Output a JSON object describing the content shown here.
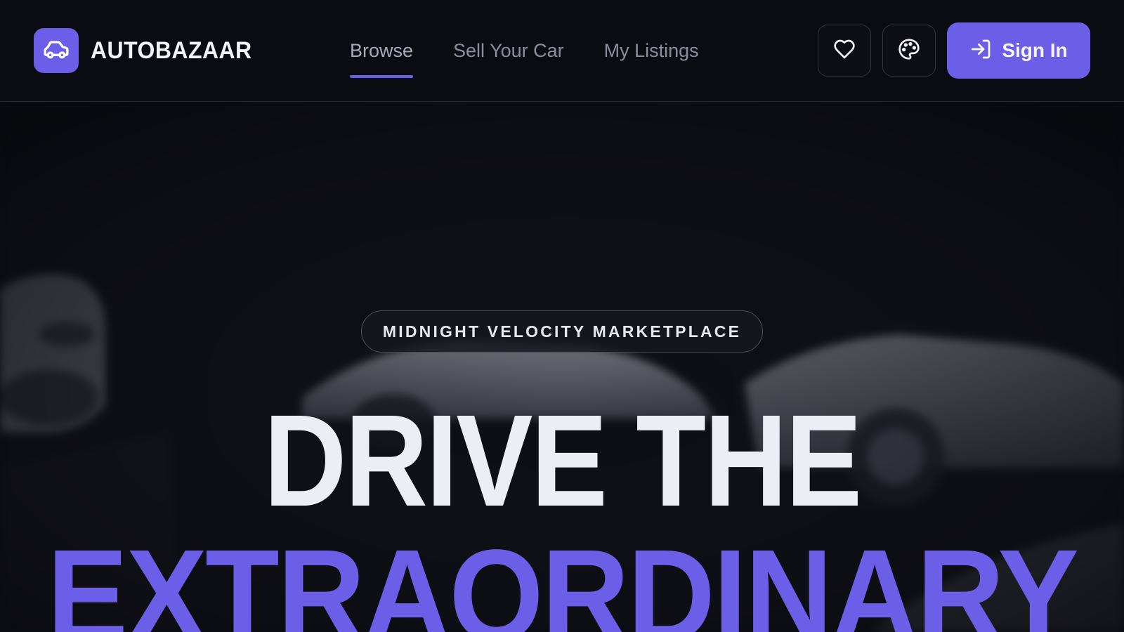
{
  "brand": {
    "name": "AUTOBAZAAR",
    "logo_icon": "car-icon",
    "accent": "#6d5ee8"
  },
  "nav": {
    "links": [
      {
        "label": "Browse",
        "active": true
      },
      {
        "label": "Sell Your Car",
        "active": false
      },
      {
        "label": "My Listings",
        "active": false
      }
    ],
    "favorites_icon": "heart-icon",
    "theme_icon": "palette-icon",
    "sign_in": {
      "label": "Sign In",
      "icon": "sign-in-icon"
    }
  },
  "hero": {
    "badge": "MIDNIGHT VELOCITY MARKETPLACE",
    "headline_line1": "DRIVE THE",
    "headline_line2": "EXTRAORDINARY",
    "headline_accent": "#6d5ee8"
  }
}
